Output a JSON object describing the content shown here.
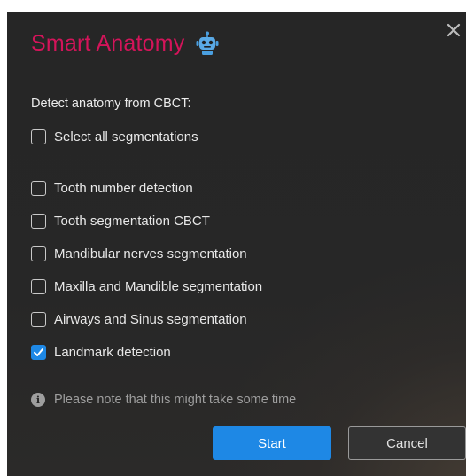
{
  "dialog": {
    "title": "Smart Anatomy",
    "title_color": "#d4145a",
    "title_icon": "robot-icon",
    "close_icon": "close-icon",
    "section_label": "Detect anatomy from CBCT:",
    "select_all": {
      "label": "Select all segmentations",
      "checked": false
    },
    "options": [
      {
        "label": "Tooth number detection",
        "checked": false
      },
      {
        "label": "Tooth segmentation CBCT",
        "checked": false
      },
      {
        "label": "Mandibular nerves segmentation",
        "checked": false
      },
      {
        "label": "Maxilla and Mandible segmentation",
        "checked": false
      },
      {
        "label": "Airways and Sinus segmentation",
        "checked": false
      },
      {
        "label": "Landmark detection",
        "checked": true
      }
    ],
    "note": "Please note that this might take some time",
    "note_icon": "info-icon",
    "buttons": {
      "start": "Start",
      "cancel": "Cancel"
    },
    "accent_color": "#1e88e5"
  }
}
